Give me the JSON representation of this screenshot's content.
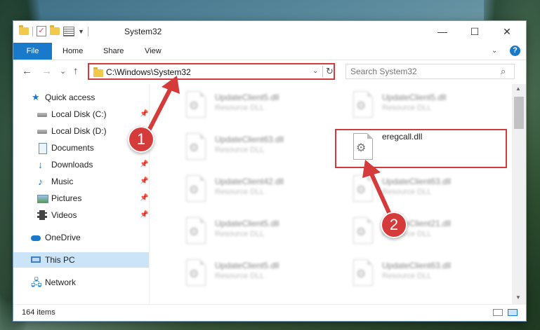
{
  "window": {
    "title": "System32",
    "minimize_glyph": "—",
    "maximize_glyph": "☐",
    "close_glyph": "✕"
  },
  "ribbon": {
    "tabs": [
      "File",
      "Home",
      "Share",
      "View"
    ],
    "expand_glyph": "⌄",
    "help_glyph": "?"
  },
  "navigation": {
    "back_glyph": "←",
    "forward_glyph": "→",
    "recent_glyph": "⌄",
    "up_glyph": "↑",
    "address": "C:\\Windows\\System32",
    "address_dropdown_glyph": "⌄",
    "refresh_glyph": "↻",
    "search_placeholder": "Search System32",
    "search_glyph": "⌕"
  },
  "sidebar": {
    "items": [
      {
        "label": "Quick access",
        "icon": "star-icon"
      },
      {
        "label": "Local Disk (C:)",
        "icon": "disk-icon",
        "pinned": true
      },
      {
        "label": "Local Disk (D:)",
        "icon": "disk-icon",
        "pinned": false
      },
      {
        "label": "Documents",
        "icon": "documents-icon",
        "pinned": true
      },
      {
        "label": "Downloads",
        "icon": "downloads-icon",
        "pinned": true
      },
      {
        "label": "Music",
        "icon": "music-icon",
        "pinned": true
      },
      {
        "label": "Pictures",
        "icon": "pictures-icon",
        "pinned": true
      },
      {
        "label": "Videos",
        "icon": "videos-icon",
        "pinned": true
      },
      {
        "label": "OneDrive",
        "icon": "onedrive-icon"
      },
      {
        "label": "This PC",
        "icon": "this-pc-icon",
        "selected": true
      },
      {
        "label": "Network",
        "icon": "network-icon"
      }
    ],
    "pin_glyph": "📌"
  },
  "files": {
    "left_column": [
      {
        "name": "UpdateClient5.dll",
        "type": "Resource DLL"
      },
      {
        "name": "UpdateClient63.dll",
        "type": "Resource DLL"
      },
      {
        "name": "UpdateClient42.dll",
        "type": "Resource DLL"
      },
      {
        "name": "UpdateClient5.dll",
        "type": "Resource DLL"
      },
      {
        "name": "UpdateClient5.dll",
        "type": "Resource DLL"
      }
    ],
    "right_column": [
      {
        "name": "UpdateClient5.dll",
        "type": "Resource DLL"
      },
      {
        "name": "eregcall.dll",
        "type": "",
        "highlighted": true
      },
      {
        "name": "UpdateClient63.dll",
        "type": "Resource DLL"
      },
      {
        "name": "UpdateClient21.dll",
        "type": "Resource DLL"
      },
      {
        "name": "UpdateClient63.dll",
        "type": "Resource DLL"
      }
    ]
  },
  "scrollbar": {
    "up_glyph": "▲",
    "down_glyph": "▼"
  },
  "status": {
    "item_count": "164 items"
  },
  "annotations": {
    "step1": "1",
    "step2": "2",
    "color": "#d63b3b"
  }
}
